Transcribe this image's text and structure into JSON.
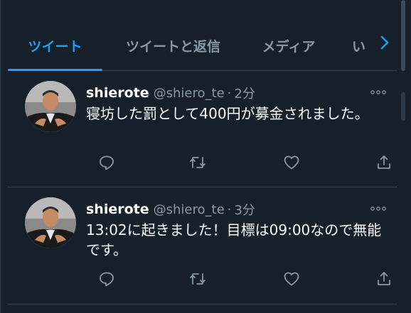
{
  "tabs": [
    {
      "label": "ツイート",
      "active": true
    },
    {
      "label": "ツイートと返信",
      "active": false
    },
    {
      "label": "メディア",
      "active": false
    },
    {
      "label": "い",
      "active": false
    }
  ],
  "colors": {
    "background": "#15202b",
    "accent": "#1da1f2",
    "secondary_text": "#8899a6",
    "divider": "#38444d"
  },
  "tweets": [
    {
      "name": "shierote",
      "handle": "@shiero_te",
      "separator": "·",
      "time": "2分",
      "text": "寝坊した罰として400円が募金されました。",
      "icons": [
        "reply-icon",
        "retweet-icon",
        "like-icon",
        "share-icon"
      ]
    },
    {
      "name": "shierote",
      "handle": "@shiero_te",
      "separator": "·",
      "time": "3分",
      "text": "13:02に起きました！目標は09:00なので無能です。",
      "icons": [
        "reply-icon",
        "retweet-icon",
        "like-icon",
        "share-icon"
      ]
    }
  ]
}
